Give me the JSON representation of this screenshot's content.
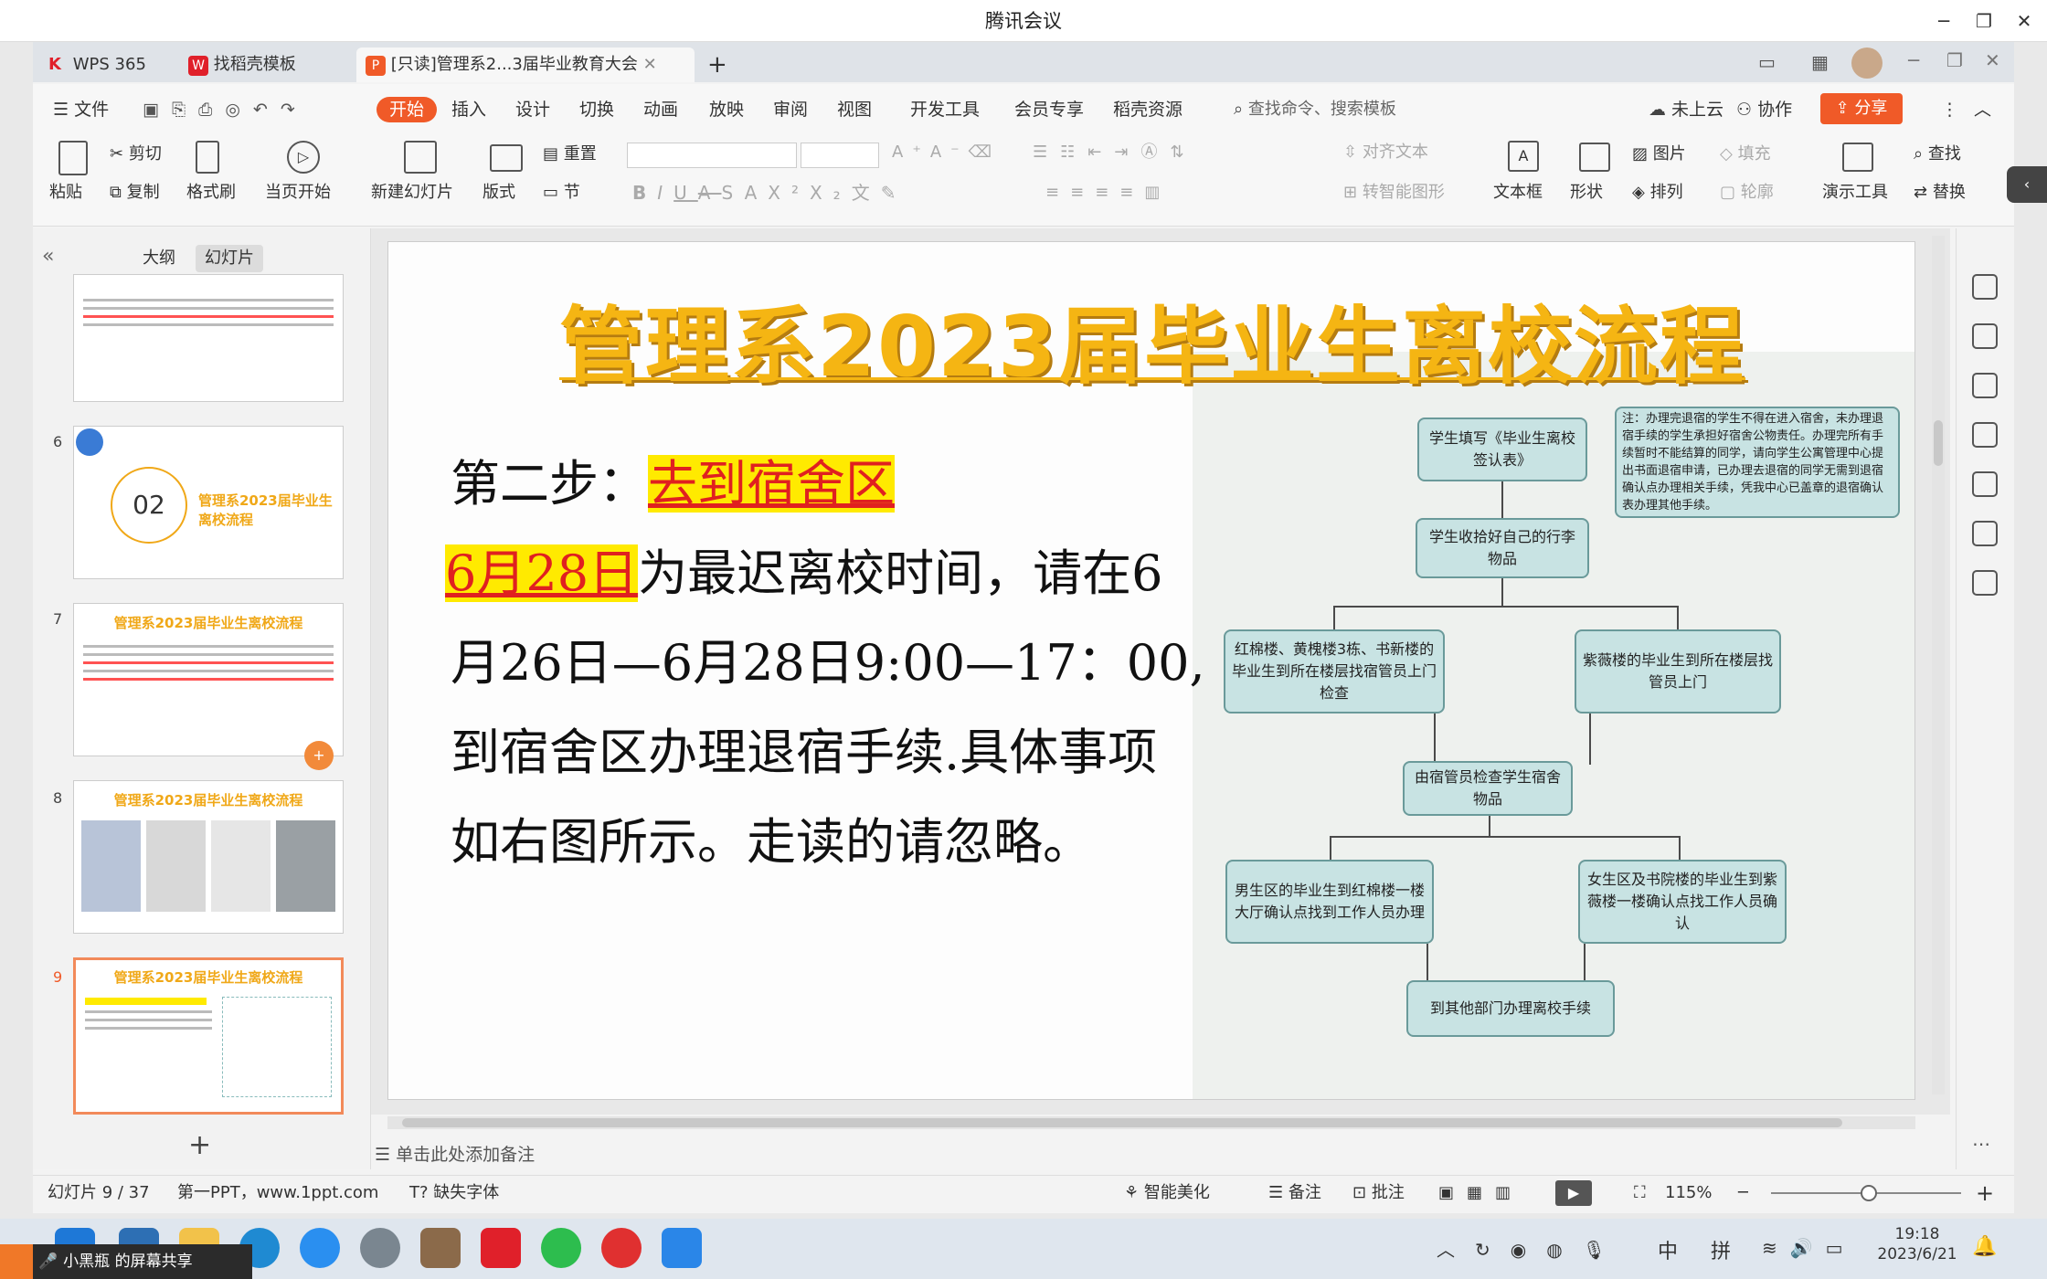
{
  "meeting": {
    "title": "腾讯会议"
  },
  "tabs": {
    "wps": "WPS 365",
    "template": "找稻壳模板",
    "doc": "[只读]管理系2...3届毕业教育大会",
    "add": "+"
  },
  "menu": {
    "file": "文件",
    "start": "开始",
    "insert": "插入",
    "design": "设计",
    "switch": "切换",
    "animation": "动画",
    "slideshow": "放映",
    "review": "审阅",
    "view": "视图",
    "devtools": "开发工具",
    "member": "会员专享",
    "docer": "稻壳资源",
    "search_placeholder": "查找命令、搜索模板",
    "cloud": "未上云",
    "collab": "协作",
    "share": "分享"
  },
  "ribbon": {
    "paste": "粘贴",
    "cut": "剪切",
    "copy": "复制",
    "format_painter": "格式刷",
    "from_current": "当页开始",
    "new_slide": "新建幻灯片",
    "layout": "版式",
    "reset": "重置",
    "section": "节",
    "align_text": "对齐文本",
    "smart_shape": "转智能图形",
    "textbox": "文本框",
    "shape": "形状",
    "picture": "图片",
    "arrange": "排列",
    "fill": "填充",
    "outline": "轮廓",
    "present_tools": "演示工具",
    "find": "查找",
    "replace": "替换"
  },
  "panel": {
    "outline_tab": "大纲",
    "slides_tab": "幻灯片",
    "add": "+"
  },
  "thumbs": {
    "n6": "6",
    "n7": "7",
    "n8": "8",
    "n9": "9",
    "t6_num": "02",
    "t6_title": "管理系2023届毕业生离校流程",
    "t7_title": "管理系2023届毕业生离校流程",
    "t8_title": "管理系2023届毕业生离校流程",
    "t9_title": "管理系2023届毕业生离校流程"
  },
  "slide": {
    "title": "管理系2023届毕业生离校流程",
    "step_label": "第二步：",
    "step_place": "去到宿舍区",
    "date_hl": "6月28日",
    "line1": "为最迟离校时间，请在6",
    "line2": "月26日—6月28日9:00—17：00,",
    "line3": "到宿舍区办理退宿手续.具体事项",
    "line4": "如右图所示。走读的请忽略。"
  },
  "flow": {
    "n1": "学生填写《毕业生离校签认表》",
    "note": "注：办理完退宿的学生不得在进入宿舍，未办理退宿手续的学生承担好宿舍公物责任。办理完所有手续暂时不能结算的同学，请向学生公寓管理中心提出书面退宿申请，已办理去退宿的同学无需到退宿确认点办理相关手续，凭我中心已盖章的退宿确认表办理其他手续。",
    "n2": "学生收拾好自己的行李物品",
    "n3": "红棉楼、黄槐楼3栋、书新楼的毕业生到所在楼层找宿管员上门检查",
    "n4": "紫薇楼的毕业生到所在楼层找管员上门",
    "n5": "由宿管员检查学生宿舍物品",
    "n6": "男生区的毕业生到红棉楼一楼大厅确认点找到工作人员办理",
    "n7": "女生区及书院楼的毕业生到紫薇楼一楼确认点找工作人员确认",
    "n8": "到其他部门办理离校手续"
  },
  "notes": {
    "placeholder": "单击此处添加备注"
  },
  "status": {
    "slide_pos": "幻灯片 9 / 37",
    "template": "第一PPT，www.1ppt.com",
    "missing_font": "缺失字体",
    "beautify": "智能美化",
    "notes": "备注",
    "comment": "批注",
    "zoom": "115%"
  },
  "taskbar": {
    "sharing": "小黑瓶  的屏幕共享",
    "ime_zh": "中",
    "ime_py": "拼",
    "time": "19:18",
    "date": "2023/6/21"
  },
  "colors": {
    "accent": "#f05a28",
    "title": "#f5b513",
    "flow_fill": "#c8e3e3",
    "highlight": "#ffea00",
    "red_text": "#e02020"
  }
}
